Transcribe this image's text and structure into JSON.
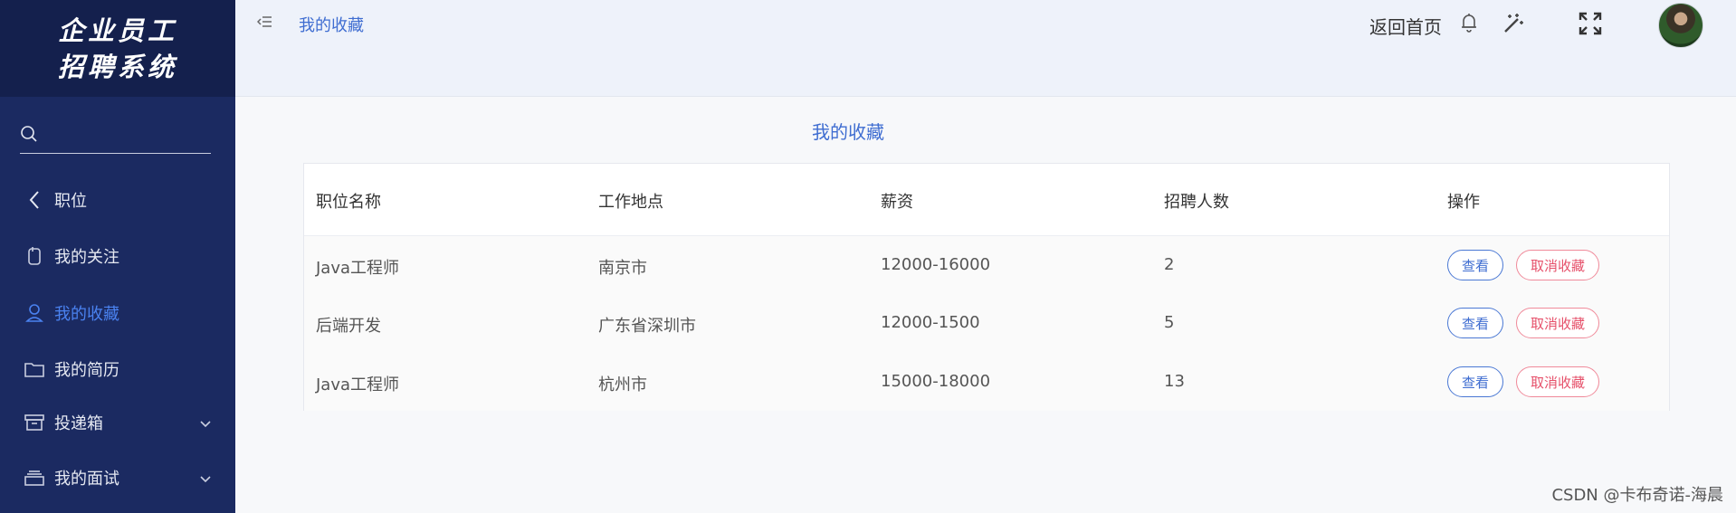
{
  "sidebar": {
    "logo": "企业员工\n招聘系统",
    "search_placeholder": "",
    "items": [
      {
        "label": "职位",
        "icon": "chevron-left-icon"
      },
      {
        "label": "我的关注",
        "icon": "phone-icon"
      },
      {
        "label": "我的收藏",
        "icon": "user-icon",
        "active": true
      },
      {
        "label": "我的简历",
        "icon": "folder-icon"
      },
      {
        "label": "投递箱",
        "icon": "box-icon",
        "expandable": true
      },
      {
        "label": "我的面试",
        "icon": "stack-icon",
        "expandable": true
      }
    ]
  },
  "header": {
    "breadcrumb": "我的收藏",
    "back_home": "返回首页"
  },
  "main": {
    "title": "我的收藏",
    "columns": [
      "职位名称",
      "工作地点",
      "薪资",
      "招聘人数",
      "操作"
    ],
    "rows": [
      {
        "name": "Java工程师",
        "location": "南京市",
        "salary": "12000-16000",
        "count": "2"
      },
      {
        "name": "后端开发",
        "location": "广东省深圳市",
        "salary": "12000-1500",
        "count": "5"
      },
      {
        "name": "Java工程师",
        "location": "杭州市",
        "salary": "15000-18000",
        "count": "13"
      }
    ],
    "view_label": "查看",
    "cancel_label": "取消收藏"
  },
  "watermark": "CSDN @卡布奇诺-海晨",
  "colors": {
    "sidebar_bg": "#1b2a61",
    "accent": "#3f6dd1",
    "danger": "#e6506a"
  }
}
